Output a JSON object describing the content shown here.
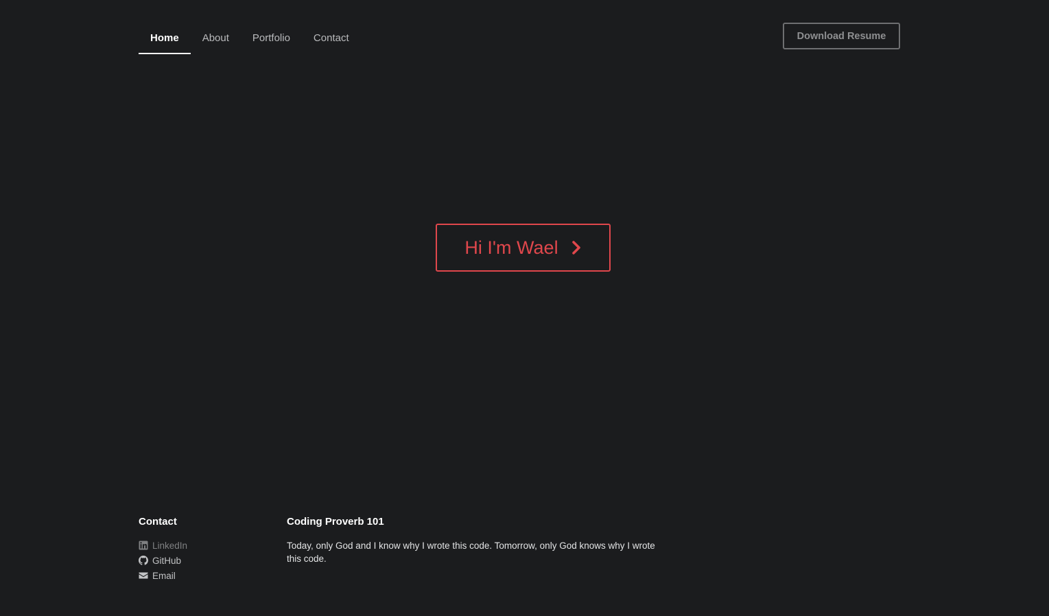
{
  "header": {
    "nav": [
      {
        "label": "Home",
        "active": true
      },
      {
        "label": "About",
        "active": false
      },
      {
        "label": "Portfolio",
        "active": false
      },
      {
        "label": "Contact",
        "active": false
      }
    ],
    "resume_button": "Download Resume"
  },
  "hero": {
    "button_label": "Hi I'm Wael",
    "icon": "chevron-right-icon"
  },
  "footer": {
    "contact": {
      "heading": "Contact",
      "links": [
        {
          "label": "LinkedIn",
          "icon": "linkedin-icon"
        },
        {
          "label": "GitHub",
          "icon": "github-icon"
        },
        {
          "label": "Email",
          "icon": "envelope-icon"
        }
      ]
    },
    "proverb": {
      "heading": "Coding Proverb 101",
      "text": "Today, only God and I know why I wrote this code. Tomorrow, only God knows why I wrote this code."
    }
  },
  "colors": {
    "background": "#1b1c1e",
    "accent": "#e0474c",
    "nav_text": "#b9babc",
    "active_text": "#ffffff",
    "button_border": "#6e6f71"
  }
}
